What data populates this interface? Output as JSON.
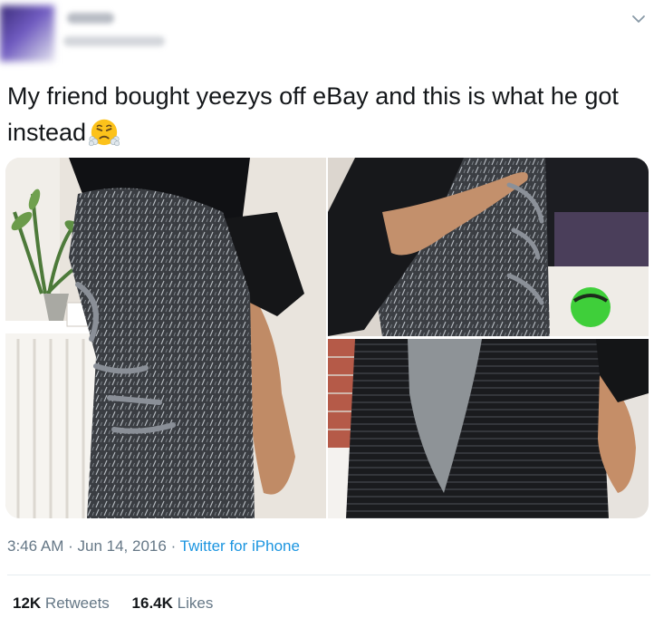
{
  "tweet": {
    "text": "My friend bought yeezys off eBay and this is what he got instead",
    "emoji": "face-with-steam-from-nose-icon",
    "time": "3:46 AM",
    "separator": "·",
    "date": "Jun 14, 2016",
    "source": "Twitter for iPhone"
  },
  "stats": {
    "retweets_count": "12K",
    "retweets_label": "Retweets",
    "likes_count": "16.4K",
    "likes_label": "Likes"
  },
  "media": {
    "photos": [
      "vest-front-photo",
      "vest-side-photo",
      "vest-back-photo"
    ]
  },
  "colors": {
    "link": "#1b95e0",
    "secondary_text": "#657786",
    "primary_text": "#14171a",
    "divider": "#e6ecf0"
  }
}
